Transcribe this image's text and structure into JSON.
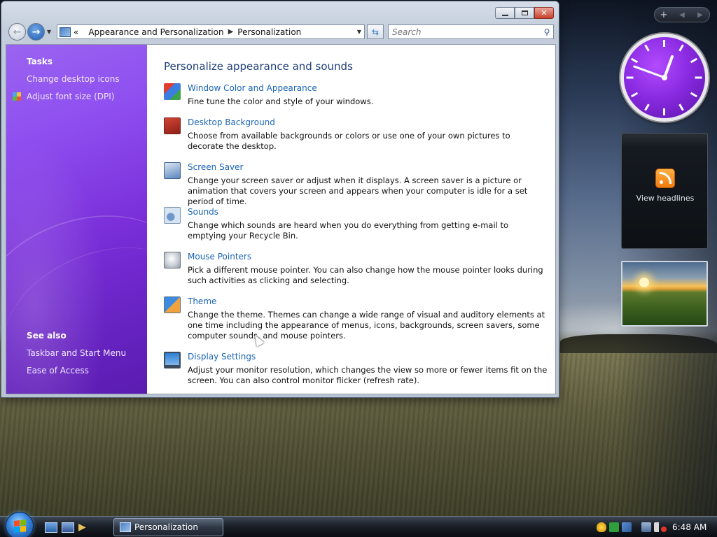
{
  "window": {
    "breadcrumb": [
      "Appearance and Personalization",
      "Personalization"
    ],
    "breadcrumb_prefix": "«",
    "search_placeholder": "Search"
  },
  "tasks": {
    "heading": "Tasks",
    "links": [
      "Change desktop icons",
      "Adjust font size (DPI)"
    ]
  },
  "see_also": {
    "heading": "See also",
    "links": [
      "Taskbar and Start Menu",
      "Ease of Access"
    ]
  },
  "main": {
    "title": "Personalize appearance and sounds",
    "items": [
      {
        "title": "Window Color and Appearance",
        "desc": "Fine tune the color and style of your windows.",
        "icon": "window-color-icon"
      },
      {
        "title": "Desktop Background",
        "desc": "Choose from available backgrounds or colors or use one of your own pictures to decorate the desktop.",
        "icon": "desktop-background-icon"
      },
      {
        "title": "Screen Saver",
        "desc": "Change your screen saver or adjust when it displays. A screen saver is a picture or animation that covers your screen and appears when your computer is idle for a set period of time.",
        "icon": "screen-saver-icon"
      },
      {
        "title": "Sounds",
        "desc": "Change which sounds are heard when you do everything from getting e-mail to emptying your Recycle Bin.",
        "icon": "sounds-icon"
      },
      {
        "title": "Mouse Pointers",
        "desc": "Pick a different mouse pointer. You can also change how the mouse pointer looks during such activities as clicking and selecting.",
        "icon": "mouse-pointers-icon"
      },
      {
        "title": "Theme",
        "desc": "Change the theme. Themes can change a wide range of visual and auditory elements at one time including the appearance of menus, icons, backgrounds, screen savers, some computer sounds, and mouse pointers.",
        "icon": "theme-icon"
      },
      {
        "title": "Display Settings",
        "desc": "Adjust your monitor resolution, which changes the view so more or fewer items fit on the screen. You can also control monitor flicker (refresh rate).",
        "icon": "display-settings-icon"
      }
    ]
  },
  "sidebar": {
    "feed_label": "View headlines"
  },
  "taskbar": {
    "task_button": "Personalization",
    "clock": "6:48 AM"
  },
  "colors": {
    "task_pane": "#7a2fd9",
    "link": "#1a64b6",
    "title": "#1e3f7a",
    "clock_face": "#8a2be2"
  }
}
